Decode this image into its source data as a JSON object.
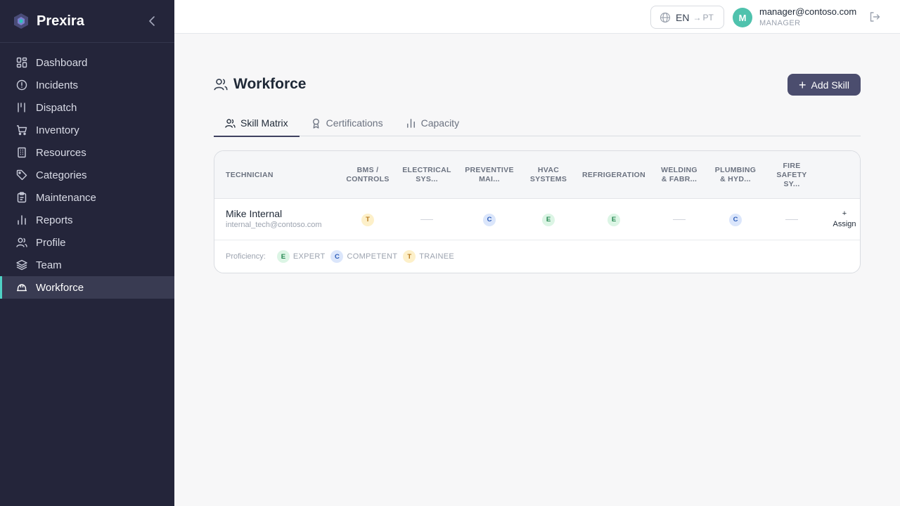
{
  "app": {
    "name": "Prexira"
  },
  "colors": {
    "sidebar_bg": "#24253a",
    "accent": "#4fd1c5",
    "primary_button": "#4b4d6e",
    "expert": "#dcf5e5",
    "competent": "#dbe6fb",
    "trainee": "#fdf0c9"
  },
  "sidebar": {
    "items": [
      {
        "label": "Dashboard",
        "icon": "dashboard-icon"
      },
      {
        "label": "Incidents",
        "icon": "alert-circle-icon"
      },
      {
        "label": "Dispatch",
        "icon": "dispatch-icon"
      },
      {
        "label": "Inventory",
        "icon": "cart-icon"
      },
      {
        "label": "Resources",
        "icon": "building-icon"
      },
      {
        "label": "Categories",
        "icon": "tag-icon"
      },
      {
        "label": "Maintenance",
        "icon": "clipboard-icon"
      },
      {
        "label": "Reports",
        "icon": "bar-chart-icon"
      },
      {
        "label": "Profile",
        "icon": "users-icon"
      },
      {
        "label": "Team",
        "icon": "layers-icon"
      },
      {
        "label": "Workforce",
        "icon": "hard-hat-icon",
        "active": true
      }
    ]
  },
  "topbar": {
    "lang_current": "EN",
    "lang_arrow": "→",
    "lang_alt": "PT",
    "user_initial": "M",
    "user_email": "manager@contoso.com",
    "user_role": "MANAGER"
  },
  "page": {
    "title": "Workforce",
    "add_button": "Add Skill",
    "tabs": [
      {
        "label": "Skill Matrix",
        "icon": "users-icon",
        "active": true
      },
      {
        "label": "Certifications",
        "icon": "award-icon"
      },
      {
        "label": "Capacity",
        "icon": "bar-chart-icon"
      }
    ]
  },
  "table": {
    "tech_header": "TECHNICIAN",
    "columns": [
      "BMS / CONTROLS",
      "ELECTRICAL SYS...",
      "PREVENTIVE MAI...",
      "HVAC SYSTEMS",
      "REFRIGERATION",
      "WELDING & FABR...",
      "PLUMBING & HYD...",
      "FIRE SAFETY SY..."
    ],
    "rows": [
      {
        "name": "Mike Internal",
        "email": "internal_tech@contoso.com",
        "cells": [
          "T",
          "",
          "C",
          "E",
          "E",
          "",
          "C",
          ""
        ],
        "assign_plus": "+",
        "assign_label": "Assign"
      }
    ]
  },
  "legend": {
    "label": "Proficiency:",
    "items": [
      {
        "letter": "E",
        "name": "EXPERT"
      },
      {
        "letter": "C",
        "name": "COMPETENT"
      },
      {
        "letter": "T",
        "name": "TRAINEE"
      }
    ]
  }
}
